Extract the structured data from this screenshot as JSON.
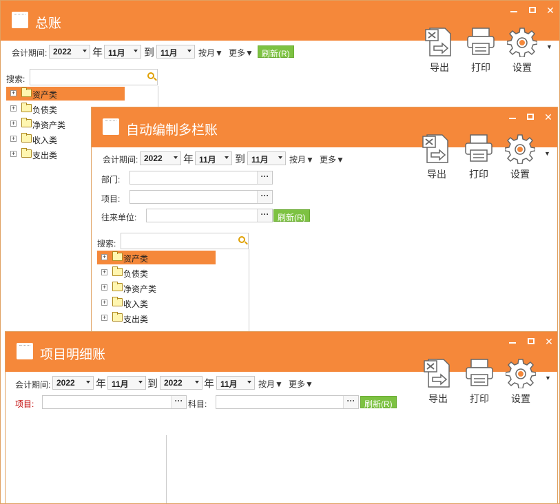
{
  "toolbar": {
    "export": "导出",
    "print": "打印",
    "settings": "设置"
  },
  "common": {
    "period_label": "会计期间:",
    "year_value": "2022",
    "year_suffix": "年",
    "month_value": "11月",
    "to": "到",
    "by_month": "按月▼",
    "more": "更多▼",
    "refresh": "刷新(R)",
    "search_label": "搜索:",
    "dots": "···"
  },
  "win1": {
    "title": "总账",
    "tree": [
      "资产类",
      "负债类",
      "净资产类",
      "收入类",
      "支出类"
    ]
  },
  "win2": {
    "title": "自动编制多栏账",
    "dept_label": "部门:",
    "project_label": "项目:",
    "partner_label": "往来单位:",
    "tree": [
      "资产类",
      "负债类",
      "净资产类",
      "收入类",
      "支出类"
    ]
  },
  "win3": {
    "title": "项目明细账",
    "project_label": "项目:",
    "subject_label": "科目:"
  }
}
